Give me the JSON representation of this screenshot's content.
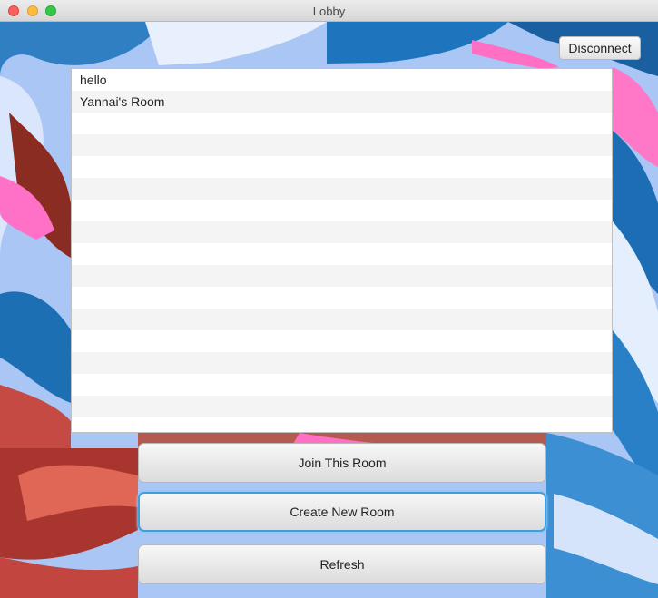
{
  "window": {
    "title": "Lobby"
  },
  "toolbar": {
    "disconnect_label": "Disconnect"
  },
  "rooms": [
    {
      "name": "hello"
    },
    {
      "name": "Yannai's Room"
    }
  ],
  "actions": {
    "join_label": "Join This Room",
    "create_label": "Create New Room",
    "refresh_label": "Refresh",
    "focused": "create"
  },
  "colors": {
    "focus_ring": "#3d9fe0",
    "close": "#fc605c",
    "minimize": "#fdbc40",
    "maximize": "#34c84a"
  }
}
